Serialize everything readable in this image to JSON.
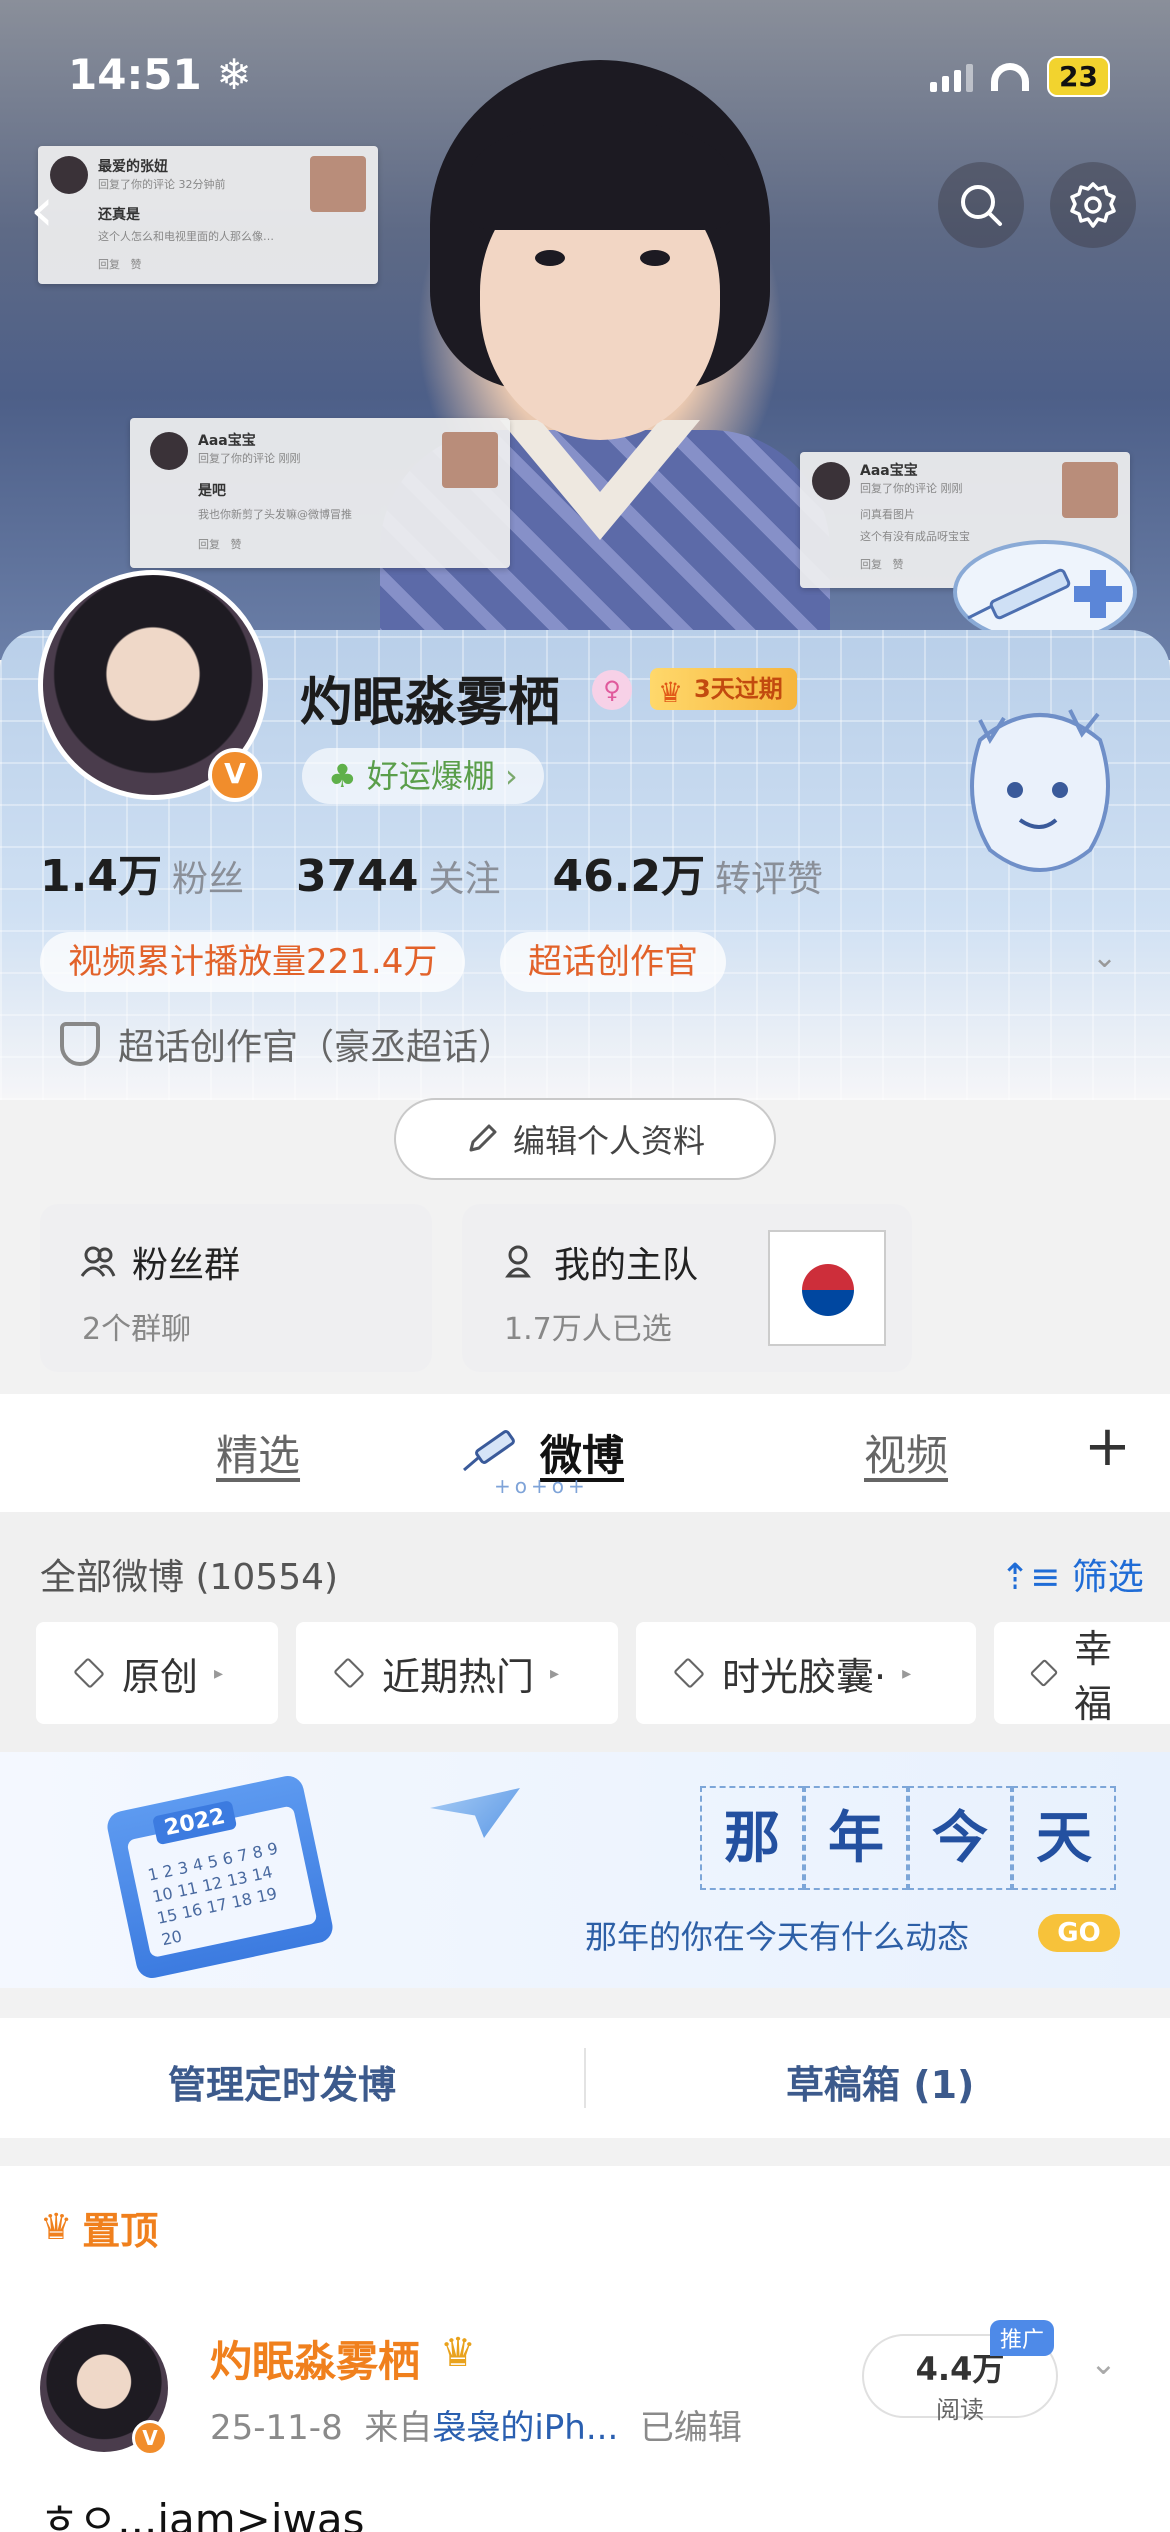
{
  "status_bar": {
    "time": "14:51",
    "battery": "23"
  },
  "overlay_cards": [
    {
      "name": "最爱的张妞",
      "sub": "回复了你的评论 32分钟前",
      "text": "还真是",
      "quote": "这个人怎么和电视里面的人那么像…",
      "reply": "回复",
      "like": "赞"
    },
    {
      "name": "Aaa宝宝",
      "sub": "回复了你的评论 刚刚",
      "text": "是吧",
      "quote": "我也你新剪了头发嘛@微博冒推",
      "reply": "回复",
      "like": "赞"
    },
    {
      "name": "Aaa宝宝",
      "sub": "回复了你的评论 刚刚",
      "text": "问真看图片",
      "quote": "这个有没有成品呀宝宝",
      "reply": "回复",
      "like": "赞"
    }
  ],
  "profile": {
    "name": "灼眠淼雾栖",
    "gender_symbol": "♀",
    "vip_label": "3天过期",
    "luck_label": "好运爆棚",
    "stats": [
      {
        "value": "1.4万",
        "label": "粉丝"
      },
      {
        "value": "3744",
        "label": "关注"
      },
      {
        "value": "46.2万",
        "label": "转评赞"
      }
    ],
    "pills": [
      "视频累计播放量221.4万",
      "超话创作官"
    ],
    "super_title": "超话创作官（豪丞超话）",
    "edit_label": "编辑个人资料"
  },
  "features": {
    "fans": {
      "title": "粉丝群",
      "sub": "2个群聊"
    },
    "team": {
      "title": "我的主队",
      "sub": "1.7万人已选"
    }
  },
  "tabs": [
    "精选",
    "微博",
    "视频"
  ],
  "filter": {
    "all_label": "全部微博 (10554)",
    "filter_label": "筛选",
    "chips": [
      "原创",
      "近期热门",
      "时光胶囊·",
      "幸福"
    ]
  },
  "memory": {
    "title": [
      "那",
      "年",
      "今",
      "天"
    ],
    "subtitle": "那年的你在今天有什么动态",
    "go": "GO",
    "calendar_year": "2022",
    "calendar_days": "1 2 3 4 5 6 7 8 9 10 11 12 13 14 15 16 17 18 19 20"
  },
  "schedule": {
    "left": "管理定时发博",
    "right": "草稿箱 (1)"
  },
  "post": {
    "pin_label": "置顶",
    "name": "灼眠淼雾栖",
    "date": "25-11-8",
    "from": "来自",
    "device": "袅袅的iPh...",
    "edited": "已编辑",
    "reads_value": "4.4万",
    "reads_label": "阅读",
    "promo": "推广",
    "text": "ㅎㅇ...iam>iwas"
  }
}
